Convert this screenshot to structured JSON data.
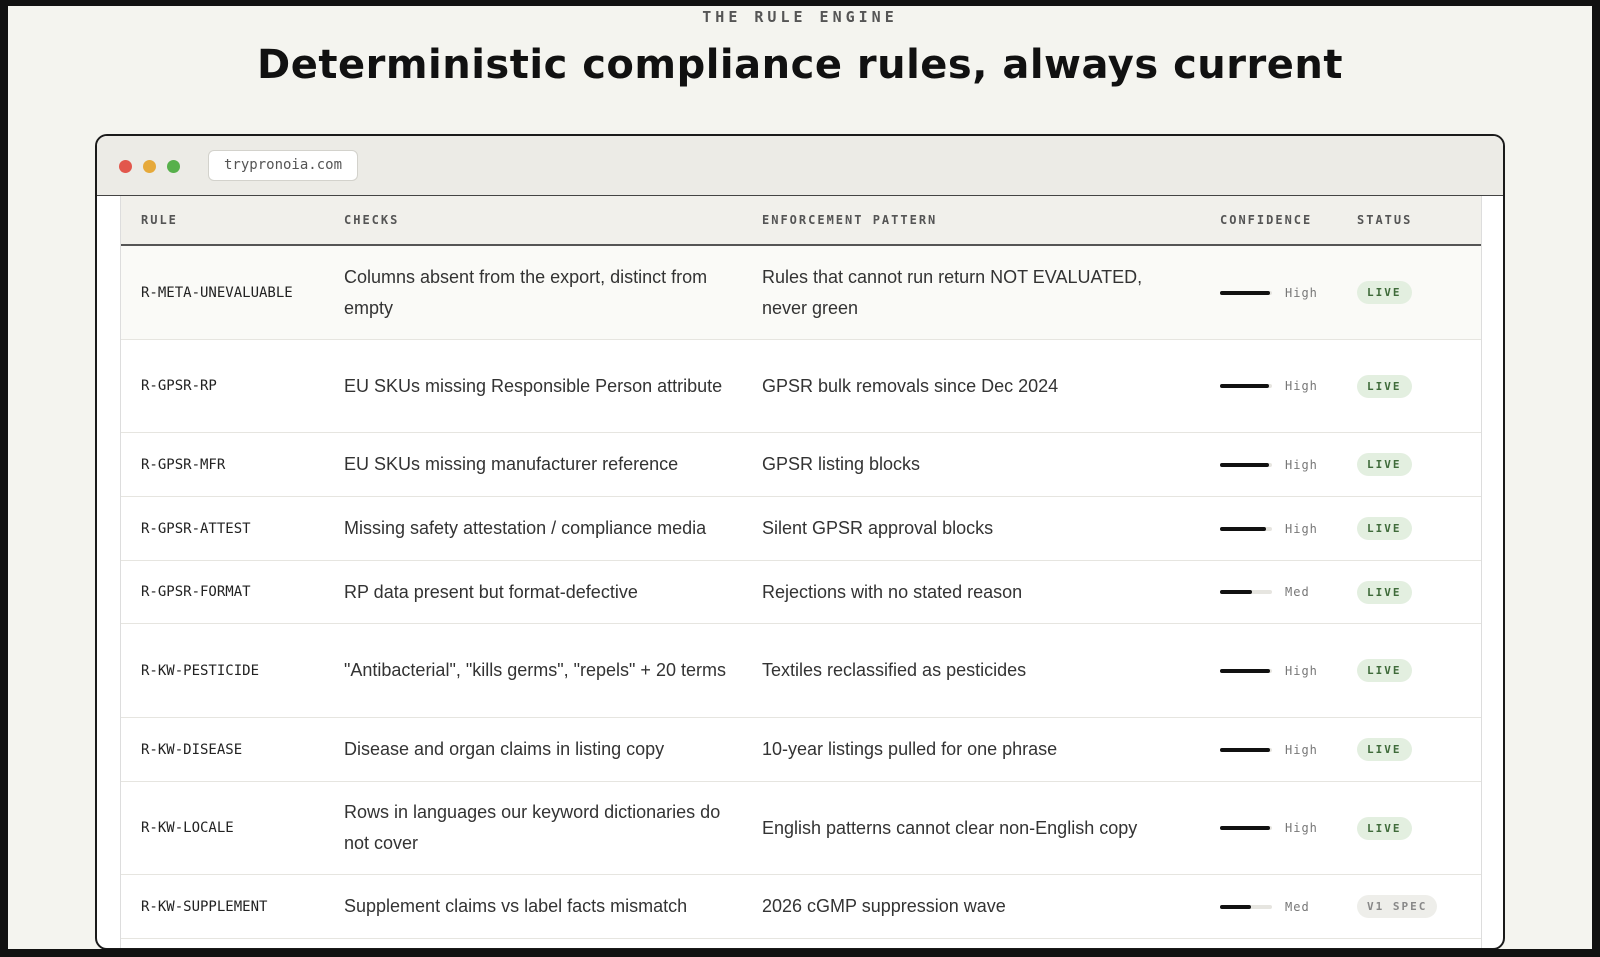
{
  "section": {
    "eyebrow": "THE RULE ENGINE",
    "headline": "Deterministic compliance rules, always current"
  },
  "browser": {
    "url": "trypronoia.com"
  },
  "table": {
    "headers": {
      "rule": "RULE",
      "checks": "CHECKS",
      "enforcement": "ENFORCEMENT PATTERN",
      "confidence": "CONFIDENCE",
      "status": "STATUS"
    },
    "rows": [
      {
        "rule": "R-META-UNEVALUABLE",
        "checks": "Columns absent from the export, distinct from empty",
        "enforcement": "Rules that cannot run return NOT EVALUATED, never green",
        "confidence": "High",
        "confidence_level": 0.96,
        "status": "LIVE"
      },
      {
        "rule": "R-GPSR-RP",
        "checks": "EU SKUs missing Responsible Person attribute",
        "enforcement": "GPSR bulk removals since Dec 2024",
        "confidence": "High",
        "confidence_level": 0.94,
        "status": "LIVE"
      },
      {
        "rule": "R-GPSR-MFR",
        "checks": "EU SKUs missing manufacturer reference",
        "enforcement": "GPSR listing blocks",
        "confidence": "High",
        "confidence_level": 0.94,
        "status": "LIVE"
      },
      {
        "rule": "R-GPSR-ATTEST",
        "checks": "Missing safety attestation / compliance media",
        "enforcement": "Silent GPSR approval blocks",
        "confidence": "High",
        "confidence_level": 0.88,
        "status": "LIVE"
      },
      {
        "rule": "R-GPSR-FORMAT",
        "checks": "RP data present but format-defective",
        "enforcement": "Rejections with no stated reason",
        "confidence": "Med",
        "confidence_level": 0.62,
        "status": "LIVE"
      },
      {
        "rule": "R-KW-PESTICIDE",
        "checks": "\"Antibacterial\", \"kills germs\", \"repels\" + 20 terms",
        "enforcement": "Textiles reclassified as pesticides",
        "confidence": "High",
        "confidence_level": 0.96,
        "status": "LIVE"
      },
      {
        "rule": "R-KW-DISEASE",
        "checks": "Disease and organ claims in listing copy",
        "enforcement": "10-year listings pulled for one phrase",
        "confidence": "High",
        "confidence_level": 0.96,
        "status": "LIVE"
      },
      {
        "rule": "R-KW-LOCALE",
        "checks": "Rows in languages our keyword dictionaries do not cover",
        "enforcement": "English patterns cannot clear non-English copy",
        "confidence": "High",
        "confidence_level": 0.96,
        "status": "LIVE"
      },
      {
        "rule": "R-KW-SUPPLEMENT",
        "checks": "Supplement claims vs label facts mismatch",
        "enforcement": "2026 cGMP suppression wave",
        "confidence": "Med",
        "confidence_level": 0.6,
        "status": "V1 SPEC"
      }
    ]
  }
}
